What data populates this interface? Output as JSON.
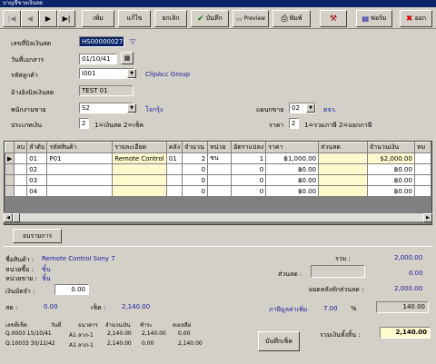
{
  "window": {
    "title": "บาญชีขายเงินสด"
  },
  "toolbar": {
    "nav_first": "|◀",
    "nav_prev": "◀",
    "nav_next": "▶",
    "nav_last": "▶|",
    "add": "เพิ่ม",
    "edit": "แก้ไข",
    "cancel": "ยกเลิก",
    "save": "บันทึก",
    "preview": "Preview",
    "print": "พิมพ์",
    "tools": "",
    "report": "ฟอร์ม",
    "exit": "ออก"
  },
  "form": {
    "doc_no_label": "เลขที่บิลเงินสด",
    "doc_no": "HS00000027",
    "doc_date_label": "วันที่เอกสาร",
    "doc_date": "01/10/41",
    "customer_label": "รหัสลูกค้า",
    "customer_code": "I001",
    "customer_name": "ClipAcc Group",
    "ref_label": "อ้างอิงบิลเงินสด",
    "ref_value": "TEST 01",
    "salesman_label": "พนักงานขาย",
    "salesman_code": "S2",
    "salesman_name": "โจกรุ้ง",
    "dept_label": "แผนกขาย",
    "dept_code": "02",
    "dept_name": "ตจว.",
    "paytype_label": "ประเภทเงิน",
    "paytype_value": "2",
    "paytype_hint": "1=เงินสด 2=เช็ค",
    "price_label": "ราคา",
    "price_value": "2",
    "price_hint": "1=รวมภาษี 2=แยกภาษี"
  },
  "grid": {
    "columns": [
      "ลบ",
      "ลำดับ",
      "รหัสสินค้า",
      "รายละเอียด",
      "คลัง",
      "จำนวน",
      "หน่วย",
      "อัตราแปลง",
      "ราคา",
      "ส่วนลด",
      "จำนวนเงิน",
      "หม"
    ],
    "rows": [
      {
        "seq": "01",
        "code": "P01",
        "desc": "Remote Control",
        "wh": "01",
        "qty": "2",
        "unit": "ชน",
        "rate": "1",
        "price": "฿1,000.00",
        "disc": "",
        "amount": "$2,000.00"
      },
      {
        "seq": "02",
        "code": "",
        "desc": "",
        "wh": "",
        "qty": "0",
        "unit": "",
        "rate": "0",
        "price": "฿0.00",
        "disc": "",
        "amount": "฿0.00"
      },
      {
        "seq": "03",
        "code": "",
        "desc": "",
        "wh": "",
        "qty": "0",
        "unit": "",
        "rate": "0",
        "price": "฿0.00",
        "disc": "",
        "amount": "฿0.00"
      },
      {
        "seq": "04",
        "code": "",
        "desc": "",
        "wh": "",
        "qty": "0",
        "unit": "",
        "rate": "0",
        "price": "฿0.00",
        "disc": "",
        "amount": "฿0.00"
      }
    ]
  },
  "bottom": {
    "detail_button": "จบรายการ",
    "product_label": "ชื่อสินค้า :",
    "product_value": "Remote Control Sony 7",
    "buy_unit_label": "หน่วยซื้อ :",
    "buy_unit_value": "ชิ้น",
    "sell_unit_label": "หน่วยขาย :",
    "sell_unit_value": "ชิ้น",
    "extra_label": "เงินมัดจำ :",
    "extra_value": "0.00",
    "cash_label": "สด :",
    "cash_value": "0.00",
    "cheque_label": "เช็ค :",
    "cheque_value": "2,140.00",
    "total_label": "รวม :",
    "total_value": "2,000.00",
    "discount_label": "ส่วนลด :",
    "discount_value": "0.00",
    "after_disc_label": "ยอดหลังหักส่วนลด :",
    "after_disc_value": "2,000.00",
    "vat_label": "ภาษีมูลค่าเพิ่ม",
    "vat_rate": "7.00",
    "vat_pct": "%",
    "vat_value": "140.00",
    "grand_label": "รวมเงินทั้งสิ้น :",
    "grand_value": "2,140.00",
    "cheque_headers": [
      "เลขที่เช็ค",
      "วันที่",
      "ธนาคาร",
      "จำนวนเงิน",
      "ชำระ",
      "คงเหลือ"
    ],
    "cheque_rows": [
      [
        "Q.0003 15/10/41",
        "A1 ลาภ-1",
        "2,140.00",
        "2,140.00",
        "0.00",
        ""
      ],
      [
        "Q.10033 30/12/42",
        "A1 ลาภ-1",
        "2,140.00",
        "0.00",
        "2,140.00",
        ""
      ]
    ],
    "record_cheque_button": "บันทึกเช็ค"
  },
  "colors": {
    "title_bar": "#0a246a",
    "face": "#d4d0c8",
    "grid_highlight": "#fffacd",
    "label_blue": "#1a1aa0"
  }
}
